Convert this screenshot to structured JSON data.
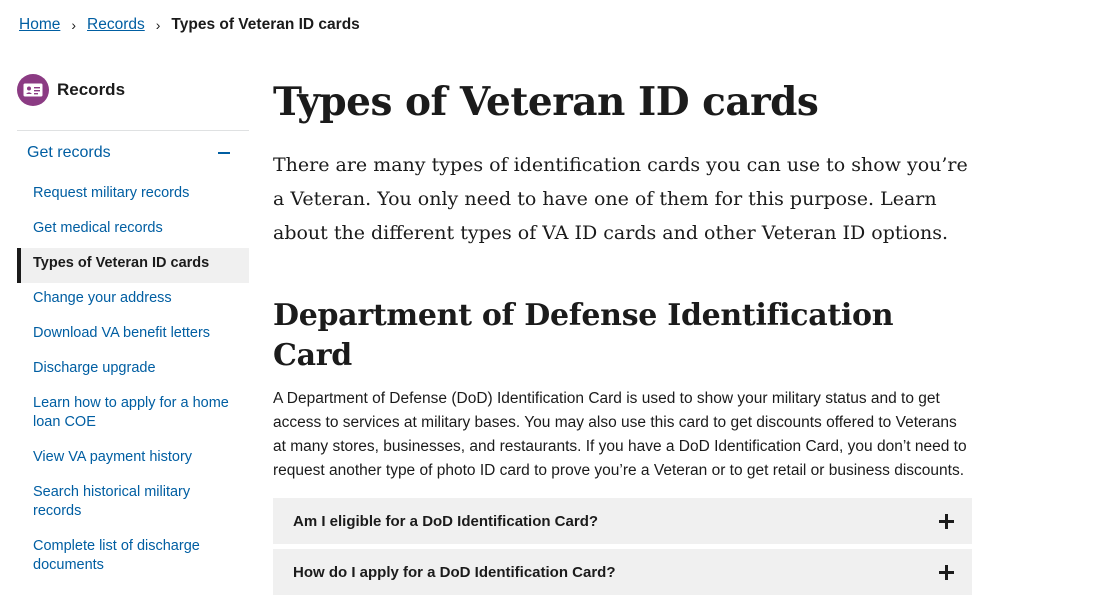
{
  "breadcrumb": {
    "items": [
      "Home",
      "Records"
    ],
    "current": "Types of Veteran ID cards",
    "separator": "›"
  },
  "sidebar": {
    "title": "Records",
    "icon": "id-card-icon",
    "section": "Get records",
    "items": [
      {
        "label": "Request military records"
      },
      {
        "label": "Get medical records"
      },
      {
        "label": "Types of Veteran ID cards",
        "active": true
      },
      {
        "label": "Change your address"
      },
      {
        "label": "Download VA benefit letters"
      },
      {
        "label": "Discharge upgrade"
      },
      {
        "label": "Learn how to apply for a home loan COE"
      },
      {
        "label": "View VA payment history"
      },
      {
        "label": "Search historical military records"
      },
      {
        "label": "Complete list of discharge documents"
      }
    ]
  },
  "main": {
    "title": "Types of Veteran ID cards",
    "intro": "There are many types of identification cards you can use to show you’re a Veteran. You only need to have one of them for this purpose. Learn about the different types of VA ID cards and other Veteran ID options.",
    "section_title": "Department of Defense Identification Card",
    "section_body": "A Department of Defense (DoD) Identification Card is used to show your military status and to get access to services at military bases. You may also use this card to get discounts offered to Veterans at many stores, businesses, and restaurants. If you have a DoD Identification Card, you don’t need to request another type of photo ID card to prove you’re a Veteran or to get retail or business discounts.",
    "accordion": [
      {
        "label": "Am I eligible for a DoD Identification Card?"
      },
      {
        "label": "How do I apply for a DoD Identification Card?"
      }
    ]
  },
  "colors": {
    "link": "#005ea2",
    "icon_bg": "#8b3b83",
    "accordion_bg": "#f0f0f0",
    "text": "#1b1b1b"
  }
}
